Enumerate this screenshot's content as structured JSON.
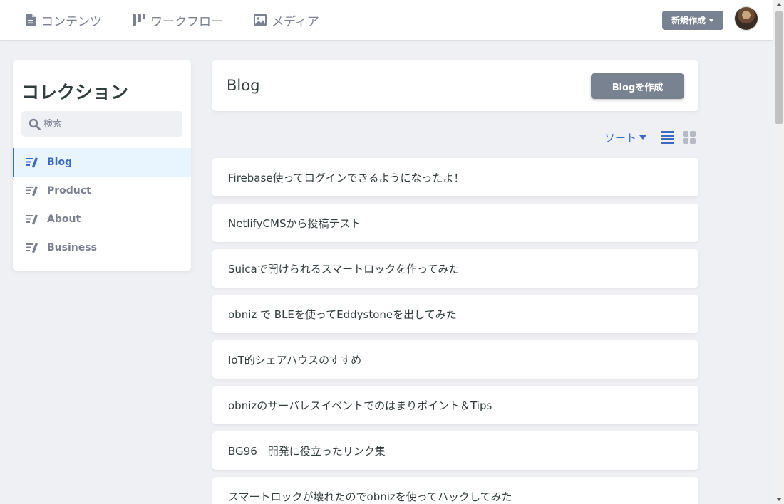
{
  "header": {
    "nav": [
      {
        "label": "コンテンツ",
        "icon": "document-icon"
      },
      {
        "label": "ワークフロー",
        "icon": "workflow-icon"
      },
      {
        "label": "メディア",
        "icon": "image-icon"
      }
    ],
    "new_button": "新規作成"
  },
  "sidebar": {
    "title": "コレクション",
    "search_placeholder": "検索",
    "collections": [
      {
        "label": "Blog",
        "active": true
      },
      {
        "label": "Product",
        "active": false
      },
      {
        "label": "About",
        "active": false
      },
      {
        "label": "Business",
        "active": false
      }
    ]
  },
  "main": {
    "title": "Blog",
    "create_button": "Blogを作成",
    "sort_label": "ソート",
    "entries": [
      "Firebase使ってログインできるようになったよ！",
      "NetlifyCMSから投稿テスト",
      "Suicaで開けられるスマートロックを作ってみた",
      "obniz で BLEを使ってEddystoneを出してみた",
      "IoT的シェアハウスのすすめ",
      "obnizのサーバレスイベントでのはまりポイント＆Tips",
      "BG96　開発に役立ったリンク集",
      "スマートロックが壊れたのでobnizを使ってハックしてみた"
    ]
  },
  "colors": {
    "accent": "#3a69c7",
    "button_gray": "#798291",
    "background": "#eff0f4",
    "active_item_bg": "#e8f5fe"
  }
}
